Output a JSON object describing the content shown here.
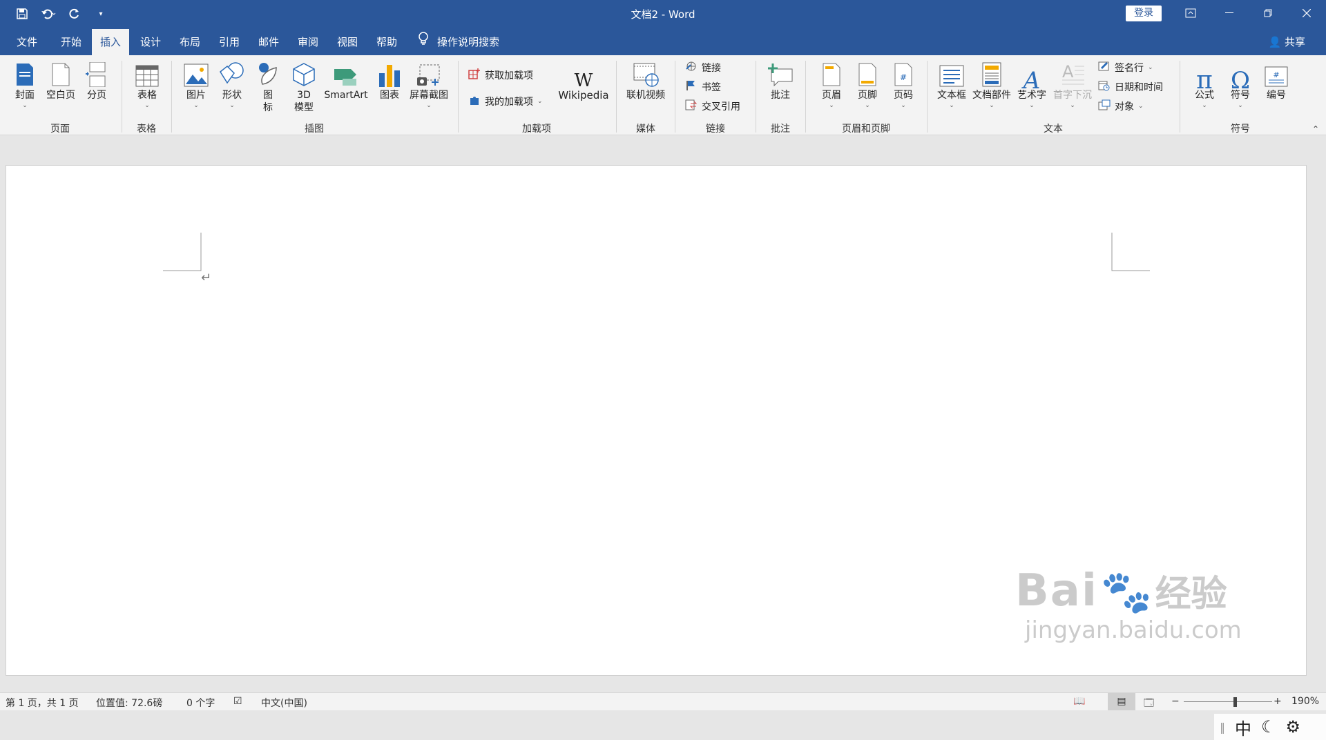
{
  "qat": {
    "save_icon": "save-icon",
    "undo_icon": "undo-icon",
    "redo_icon": "redo-icon",
    "customize_icon": "customize-qat-icon"
  },
  "window": {
    "title": "文档2  -  Word",
    "login": "登录"
  },
  "tabs": [
    "文件",
    "开始",
    "插入",
    "设计",
    "布局",
    "引用",
    "邮件",
    "审阅",
    "视图",
    "帮助"
  ],
  "active_tab": "插入",
  "tell_me": "操作说明搜索",
  "share": "共享",
  "ribbon": {
    "pages": {
      "label": "页面",
      "cover": "封面",
      "blank": "空白页",
      "break": "分页"
    },
    "tables": {
      "label": "表格",
      "table": "表格"
    },
    "illustrations": {
      "label": "插图",
      "picture": "图片",
      "shapes": "形状",
      "icons_l1": "图",
      "icons_l2": "标",
      "model_l1": "3D",
      "model_l2": "模型",
      "smartart": "SmartArt",
      "chart": "图表",
      "screenshot": "屏幕截图"
    },
    "addins": {
      "label": "加载项",
      "get": "获取加载项",
      "mine": "我的加载项",
      "wikipedia": "Wikipedia"
    },
    "media": {
      "label": "媒体",
      "video": "联机视频"
    },
    "links": {
      "label": "链接",
      "link": "链接",
      "bookmark": "书签",
      "crossref": "交叉引用"
    },
    "comments": {
      "label": "批注",
      "comment": "批注"
    },
    "header_footer": {
      "label": "页眉和页脚",
      "header": "页眉",
      "footer": "页脚",
      "page_number": "页码"
    },
    "text": {
      "label": "文本",
      "textbox": "文本框",
      "quickparts": "文档部件",
      "wordart": "艺术字",
      "dropcap": "首字下沉",
      "signature": "签名行",
      "datetime": "日期和时间",
      "object": "对象"
    },
    "symbols": {
      "label": "符号",
      "equation": "公式",
      "symbol": "符号",
      "numbering": "编号"
    }
  },
  "status": {
    "page": "第 1 页，共 1 页",
    "position": "位置值: 72.6磅",
    "words": "0 个字",
    "language": "中文(中国)",
    "zoom": "190%"
  },
  "ime": {
    "mode": "中"
  },
  "watermark": {
    "brand": "Bai",
    "brand_cn": "经验",
    "url": "jingyan.baidu.com"
  },
  "colors": {
    "accent": "#2b579a"
  }
}
